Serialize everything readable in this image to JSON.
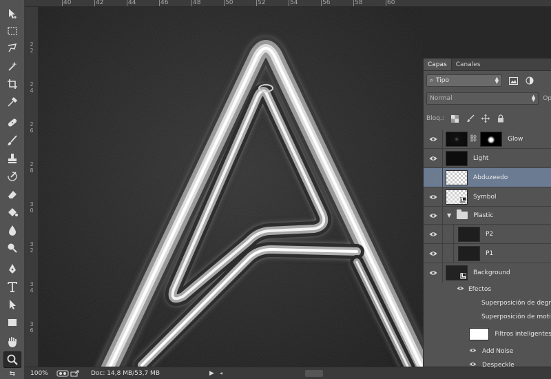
{
  "rulers": {
    "top": [
      "40",
      "42",
      "44",
      "46",
      "48",
      "50",
      "52",
      "54",
      "56",
      "58",
      "60"
    ],
    "left": [
      "2|2",
      "2|4",
      "2|6",
      "2|8",
      "3|0",
      "3|2",
      "3|4",
      "3|6"
    ]
  },
  "status": {
    "zoom": "100%",
    "doc": "Doc: 14,8 MB/53,7 MB"
  },
  "panel": {
    "tabs": [
      "Capas",
      "Canales"
    ],
    "filter": "Tipo",
    "blend_mode": "Normal",
    "opacity_label": "Op",
    "lock_label": "Bloq.:"
  },
  "layers": [
    {
      "name": "Glow"
    },
    {
      "name": "Light"
    },
    {
      "name": "Abduzeedo"
    },
    {
      "name": "Symbol"
    },
    {
      "name": "Plastic"
    },
    {
      "name": "P2"
    },
    {
      "name": "P1"
    },
    {
      "name": "Background"
    }
  ],
  "effects": {
    "label": "Efectos",
    "items": [
      "Superposición de degr",
      "Superposición de motiv"
    ]
  },
  "smart_filters": {
    "label": "Filtros inteligentes",
    "items": [
      "Add Noise",
      "Despeckle"
    ]
  },
  "icons": {
    "eye": "eye-icon",
    "folder": "folder-icon",
    "chain": "link-icon"
  },
  "colors": {
    "selection": "#6b7b92",
    "panel": "#535353",
    "canvas": "#1a1a1a"
  }
}
